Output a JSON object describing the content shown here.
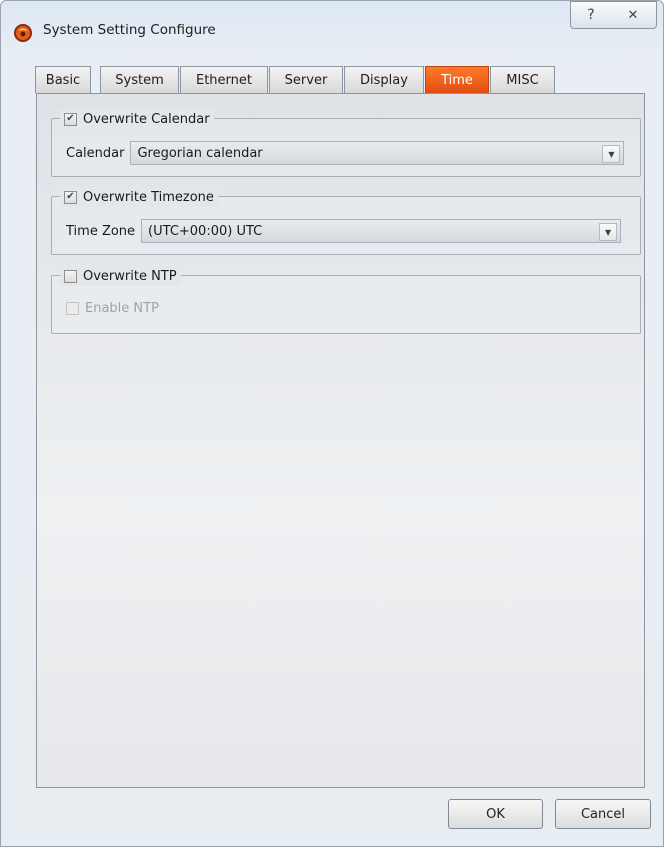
{
  "window": {
    "title": "System Setting Configure"
  },
  "title_buttons": {
    "help": "?",
    "close": "✕"
  },
  "tabs": [
    {
      "label": "Basic"
    },
    {
      "label": "System"
    },
    {
      "label": "Ethernet"
    },
    {
      "label": "Server"
    },
    {
      "label": "Display"
    },
    {
      "label": "Time",
      "active": true
    },
    {
      "label": "MISC"
    }
  ],
  "calendar_group": {
    "legend": "Overwrite Calendar",
    "checked": true,
    "field_label": "Calendar",
    "selected": "Gregorian calendar"
  },
  "timezone_group": {
    "legend": "Overwrite Timezone",
    "checked": true,
    "field_label": "Time Zone",
    "selected": "(UTC+00:00) UTC"
  },
  "ntp_group": {
    "legend": "Overwrite NTP",
    "checked": false,
    "enable_label": "Enable NTP",
    "enable_checked": false,
    "enable_disabled": true
  },
  "footer": {
    "ok_label": "OK",
    "cancel_label": "Cancel"
  },
  "colors": {
    "active_tab": "#e8541a"
  }
}
